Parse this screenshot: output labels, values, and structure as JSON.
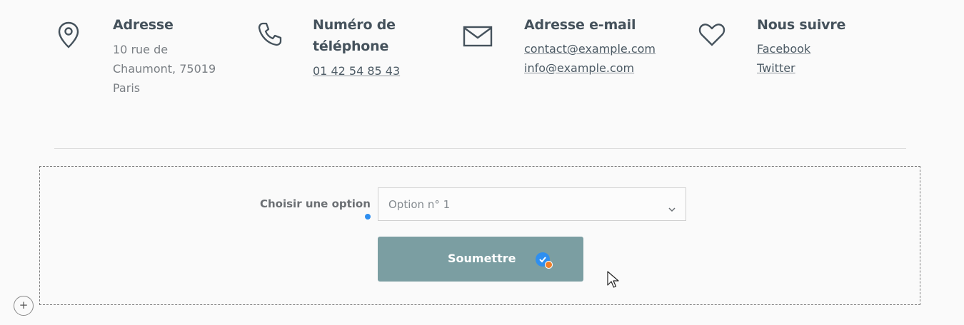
{
  "contact": {
    "address": {
      "icon": "map-pin-icon",
      "title": "Adresse",
      "lines": [
        "10 rue de",
        "Chaumont, 75019",
        "Paris"
      ]
    },
    "phone": {
      "icon": "phone-icon",
      "title_line1": "Numéro de",
      "title_line2": "téléphone",
      "number": "01 42 54 85 43"
    },
    "email": {
      "icon": "envelope-icon",
      "title": "Adresse e-mail",
      "links": [
        "contact@example.com",
        "info@example.com"
      ]
    },
    "social": {
      "icon": "heart-icon",
      "title": "Nous suivre",
      "links": [
        "Facebook",
        "Twitter"
      ]
    }
  },
  "form": {
    "label": "Choisir une option",
    "select_value": "Option n° 1",
    "submit_label": "Soumettre"
  },
  "editor": {
    "add_symbol": "+"
  },
  "colors": {
    "button": "#7b9ea2",
    "accent_blue": "#2f8ff0",
    "accent_orange": "#f07f2a",
    "text_dark": "#45525c"
  }
}
